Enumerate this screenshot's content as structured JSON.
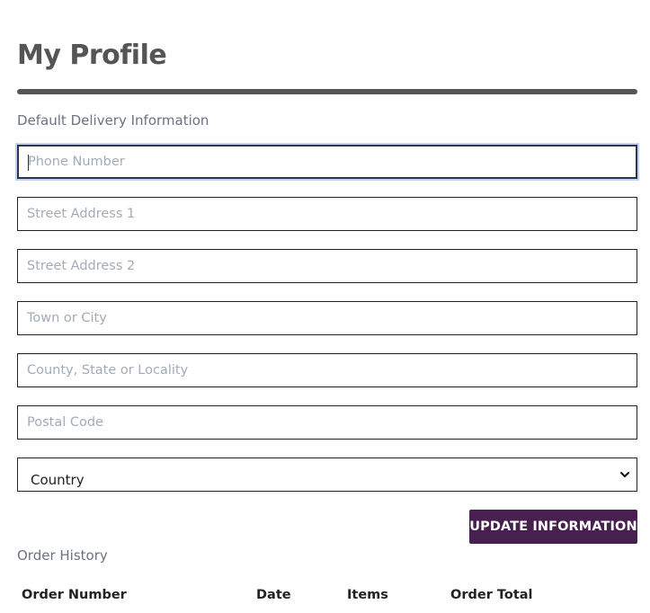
{
  "page": {
    "title": "My Profile"
  },
  "delivery": {
    "section_label": "Default Delivery Information",
    "fields": {
      "phone": {
        "placeholder": "Phone Number",
        "value": ""
      },
      "street1": {
        "placeholder": "Street Address 1",
        "value": ""
      },
      "street2": {
        "placeholder": "Street Address 2",
        "value": ""
      },
      "city": {
        "placeholder": "Town or City",
        "value": ""
      },
      "county": {
        "placeholder": "County, State or Locality",
        "value": ""
      },
      "postal": {
        "placeholder": "Postal Code",
        "value": ""
      }
    },
    "country": {
      "selected": "Country"
    },
    "update_button_label": "UPDATE INFORMATION"
  },
  "order_history": {
    "section_label": "Order History",
    "columns": [
      "Order Number",
      "Date",
      "Items",
      "Order Total"
    ]
  },
  "colors": {
    "heading": "#555555",
    "button_bg": "#47204f",
    "focus_ring": "#bcd3f5"
  }
}
